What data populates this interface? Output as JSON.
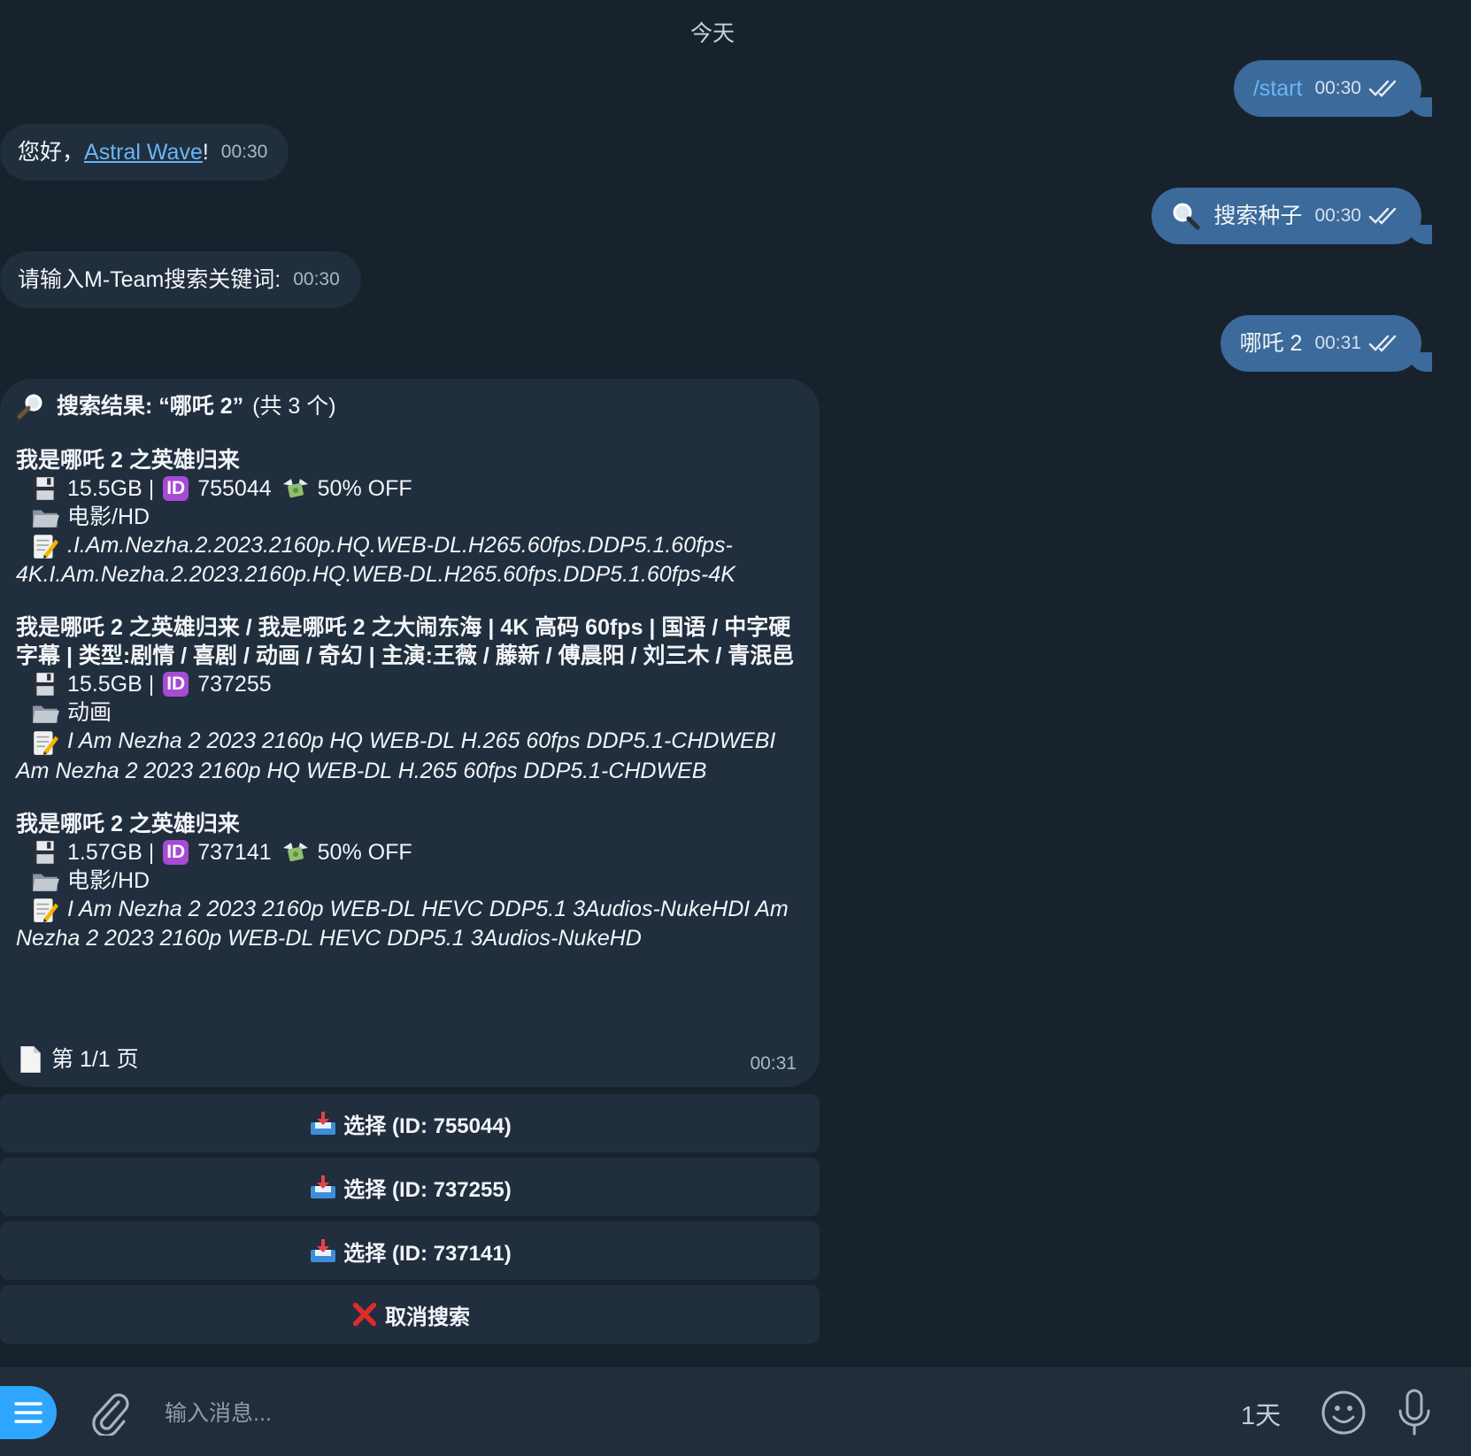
{
  "date_separator": "今天",
  "messages": {
    "m1": {
      "text": "/start",
      "time": "00:30"
    },
    "m2": {
      "prefix": "您好，",
      "link": "Astral Wave",
      "suffix": "!",
      "time": "00:30"
    },
    "m3": {
      "text": "搜索种子",
      "time": "00:30"
    },
    "m4": {
      "text": "请输入M-Team搜索关键词:",
      "time": "00:30"
    },
    "m5": {
      "text": "哪吒 2",
      "time": "00:31"
    }
  },
  "results": {
    "heading": "搜索结果: “哪吒 2”",
    "count": "(共 3 个)",
    "items": [
      {
        "title": "我是哪吒 2 之英雄归来",
        "size": "15.5GB |",
        "id": "755044",
        "discount": "50% OFF",
        "category": "电影/HD",
        "description": ".I.Am.Nezha.2.2023.2160p.HQ.WEB-DL.H265.60fps.DDP5.1.60fps-4K.I.Am.Nezha.2.2023.2160p.HQ.WEB-DL.H265.60fps.DDP5.1.60fps-4K"
      },
      {
        "title": "我是哪吒 2 之英雄归来 / 我是哪吒 2 之大闹东海 | 4K 高码 60fps | 国语 / 中字硬字幕 | 类型:剧情 / 喜剧 / 动画 / 奇幻 | 主演:王薇 / 藤新 / 傅晨阳 / 刘三木 / 青泯邑",
        "size": "15.5GB |",
        "id": "737255",
        "discount": "",
        "category": "动画",
        "description": "I Am Nezha 2 2023 2160p HQ WEB-DL H.265 60fps DDP5.1-CHDWEBI Am Nezha 2 2023 2160p HQ WEB-DL H.265 60fps DDP5.1-CHDWEB"
      },
      {
        "title": "我是哪吒 2 之英雄归来",
        "size": "1.57GB |",
        "id": "737141",
        "discount": "50% OFF",
        "category": "电影/HD",
        "description": "I Am Nezha 2 2023 2160p WEB-DL HEVC DDP5.1 3Audios-NukeHDI Am Nezha 2 2023 2160p WEB-DL HEVC DDP5.1 3Audios-NukeHD"
      }
    ],
    "page": "第 1/1 页",
    "time": "00:31",
    "id_badge": "ID"
  },
  "keyboard": {
    "select_1": "选择 (ID: 755044)",
    "select_2": "选择 (ID: 737255)",
    "select_3": "选择 (ID: 737141)",
    "cancel": "取消搜索"
  },
  "composer": {
    "placeholder": "输入消息...",
    "timer": "1天"
  },
  "colors": {
    "background": "#18222d",
    "outgoing_bubble": "#3b6a9b",
    "incoming_bubble": "#212e3e",
    "link": "#69b6f6",
    "accent": "#2ea6ff",
    "id_badge": "#a64bd5"
  },
  "icons": [
    "double-check-icon",
    "magnifier-icon",
    "floppy-disk-icon",
    "money-wings-icon",
    "folder-icon",
    "memo-icon",
    "page-icon",
    "inbox-tray-icon",
    "cross-mark-icon",
    "menu-icon",
    "paperclip-icon",
    "emoji-icon",
    "microphone-icon"
  ]
}
